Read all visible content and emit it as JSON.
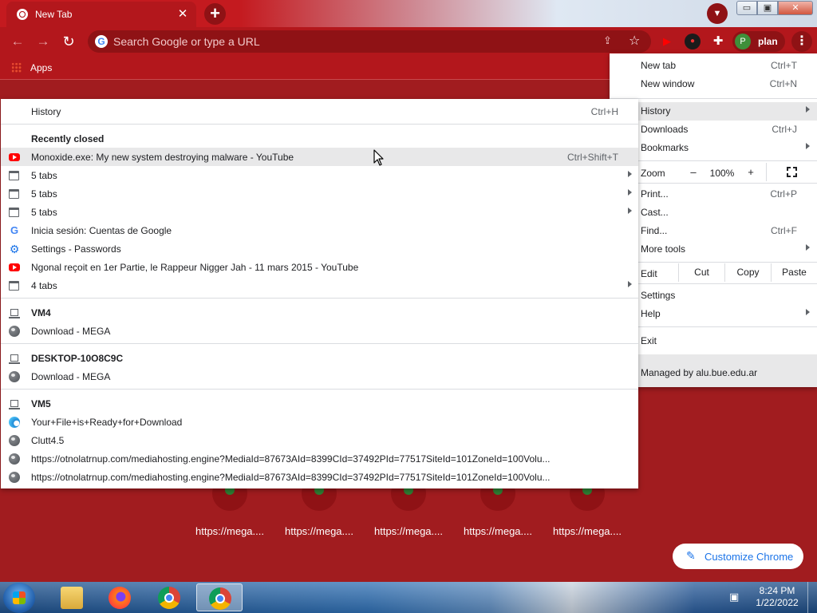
{
  "tab": {
    "title": "New Tab",
    "close": "✕"
  },
  "window": {
    "minimize": "▭",
    "maximize": "▣",
    "close": "✕"
  },
  "toolbar": {
    "back": "←",
    "forward": "→",
    "reload": "↻",
    "omnibox_placeholder": "Search Google or type a URL",
    "share": "⇪",
    "star": "☆",
    "profile_initial": "P",
    "profile_name": "plan",
    "menu": "⋮"
  },
  "bookmarks": {
    "apps": "Apps"
  },
  "main_menu": {
    "items": [
      {
        "label": "New tab",
        "shortcut": "Ctrl+T"
      },
      {
        "label": "New window",
        "shortcut": "Ctrl+N"
      },
      {
        "label": "History",
        "shortcut": ""
      },
      {
        "label": "Downloads",
        "shortcut": "Ctrl+J"
      },
      {
        "label": "Bookmarks",
        "shortcut": ""
      },
      {
        "label": "Print...",
        "shortcut": "Ctrl+P"
      },
      {
        "label": "Cast...",
        "shortcut": ""
      },
      {
        "label": "Find...",
        "shortcut": "Ctrl+F"
      },
      {
        "label": "More tools",
        "shortcut": ""
      },
      {
        "label": "Settings",
        "shortcut": ""
      },
      {
        "label": "Help",
        "shortcut": ""
      },
      {
        "label": "Exit",
        "shortcut": ""
      }
    ],
    "zoom": {
      "label": "Zoom",
      "minus": "–",
      "value": "100%",
      "plus": "+"
    },
    "edit": {
      "label": "Edit",
      "cut": "Cut",
      "copy": "Copy",
      "paste": "Paste"
    },
    "managed": "Managed by alu.bue.edu.ar"
  },
  "history_menu": {
    "header": {
      "label": "History",
      "shortcut": "Ctrl+H"
    },
    "recently_closed": "Recently closed",
    "recent": [
      {
        "icon": "youtube-icon",
        "label": "Monoxide.exe: My new system destroying malware - YouTube",
        "shortcut": "Ctrl+Shift+T"
      },
      {
        "icon": "tabs-icon",
        "label": "5 tabs"
      },
      {
        "icon": "tabs-icon",
        "label": "5 tabs"
      },
      {
        "icon": "tabs-icon",
        "label": "5 tabs"
      },
      {
        "icon": "google-icon",
        "label": "Inicia sesión: Cuentas de Google"
      },
      {
        "icon": "gear-icon",
        "label": "Settings - Passwords"
      },
      {
        "icon": "youtube-icon",
        "label": "Ngonal reçoit en 1er Partie, le Rappeur Nigger Jah - 11 mars 2015 - YouTube"
      },
      {
        "icon": "tabs-icon",
        "label": "4 tabs"
      }
    ],
    "devices": [
      {
        "name": "VM4",
        "items": [
          "Download - MEGA"
        ]
      },
      {
        "name": "DESKTOP-10O8C9C",
        "items": [
          "Download - MEGA"
        ]
      },
      {
        "name": "VM5",
        "items": [
          "Your+File+is+Ready+for+Download",
          "Clutt4.5",
          "https://otnolatrnup.com/mediahosting.engine?MediaId=87673AId=8399CId=37492PId=77517SiteId=101ZoneId=100Volu...",
          "https://otnolatrnup.com/mediahosting.engine?MediaId=87673AId=8399CId=37492PId=77517SiteId=101ZoneId=100Volu..."
        ]
      }
    ]
  },
  "ntp": {
    "tiles": [
      "https://mega....",
      "https://mega....",
      "https://mega....",
      "https://mega....",
      "https://mega...."
    ],
    "customize": "Customize Chrome"
  },
  "taskbar": {
    "time": "8:24 PM",
    "date": "1/22/2022"
  }
}
